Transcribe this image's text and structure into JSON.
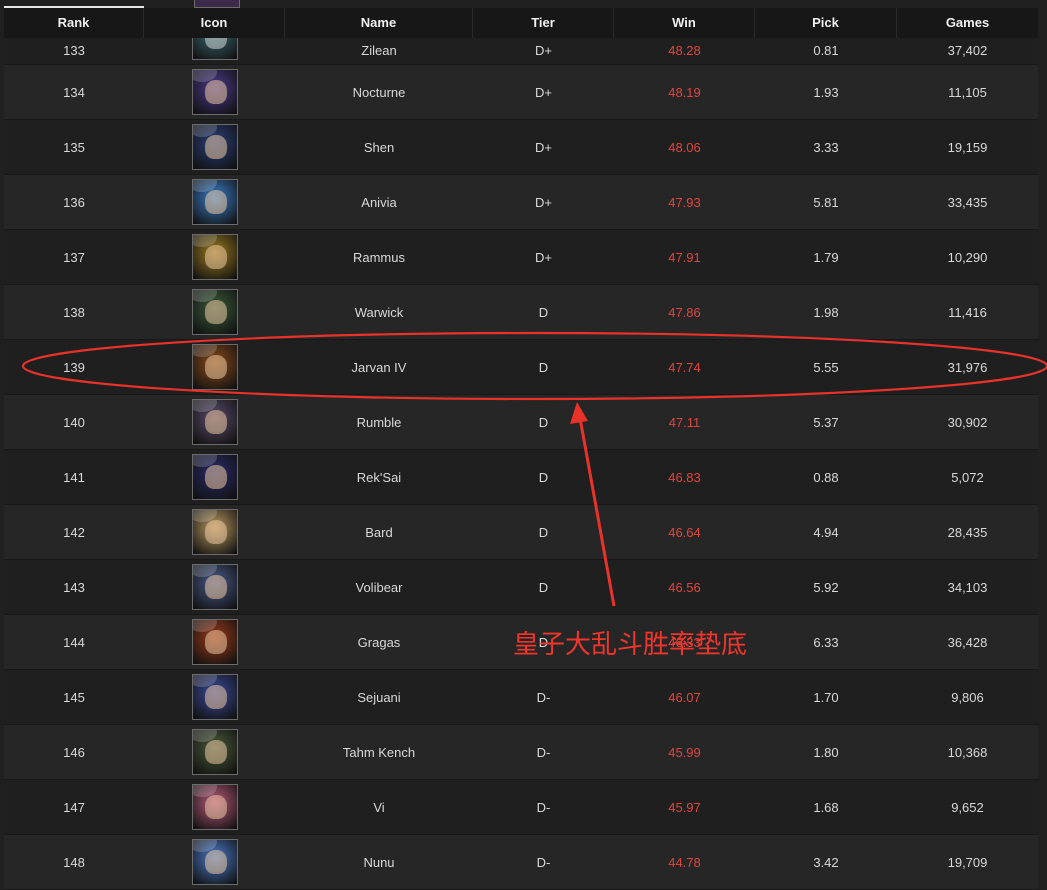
{
  "header": {
    "rank": "Rank",
    "icon": "Icon",
    "name": "Name",
    "tier": "Tier",
    "win": "Win",
    "pick": "Pick",
    "games": "Games"
  },
  "partial_row": {
    "rank": "133",
    "name": "Zilean",
    "tier": "D+",
    "win": "48.28",
    "pick": "0.81",
    "games": "37,402",
    "icon": "zilean-portrait",
    "color": "#3f6a72"
  },
  "rows": [
    {
      "rank": "134",
      "name": "Nocturne",
      "tier": "D+",
      "win": "48.19",
      "pick": "1.93",
      "games": "11,105",
      "icon": "nocturne-portrait",
      "color": "#4a3a8a"
    },
    {
      "rank": "135",
      "name": "Shen",
      "tier": "D+",
      "win": "48.06",
      "pick": "3.33",
      "games": "19,159",
      "icon": "shen-portrait",
      "color": "#2b3f7a"
    },
    {
      "rank": "136",
      "name": "Anivia",
      "tier": "D+",
      "win": "47.93",
      "pick": "5.81",
      "games": "33,435",
      "icon": "anivia-portrait",
      "color": "#3a7ec8"
    },
    {
      "rank": "137",
      "name": "Rammus",
      "tier": "D+",
      "win": "47.91",
      "pick": "1.79",
      "games": "10,290",
      "icon": "rammus-portrait",
      "color": "#9a7a20"
    },
    {
      "rank": "138",
      "name": "Warwick",
      "tier": "D",
      "win": "47.86",
      "pick": "1.98",
      "games": "11,416",
      "icon": "warwick-portrait",
      "color": "#3b5a3a"
    },
    {
      "rank": "139",
      "name": "Jarvan IV",
      "tier": "D",
      "win": "47.74",
      "pick": "5.55",
      "games": "31,976",
      "icon": "jarvan-iv-portrait",
      "color": "#8a4a1a"
    },
    {
      "rank": "140",
      "name": "Rumble",
      "tier": "D",
      "win": "47.11",
      "pick": "5.37",
      "games": "30,902",
      "icon": "rumble-portrait",
      "color": "#5a4a6a"
    },
    {
      "rank": "141",
      "name": "Rek'Sai",
      "tier": "D",
      "win": "46.83",
      "pick": "0.88",
      "games": "5,072",
      "icon": "reksai-portrait",
      "color": "#2a2a6a"
    },
    {
      "rank": "142",
      "name": "Bard",
      "tier": "D",
      "win": "46.64",
      "pick": "4.94",
      "games": "28,435",
      "icon": "bard-portrait",
      "color": "#b89860"
    },
    {
      "rank": "143",
      "name": "Volibear",
      "tier": "D",
      "win": "46.56",
      "pick": "5.92",
      "games": "34,103",
      "icon": "volibear-portrait",
      "color": "#4a5a8a"
    },
    {
      "rank": "144",
      "name": "Gragas",
      "tier": "D",
      "win": "46.33",
      "pick": "6.33",
      "games": "36,428",
      "icon": "gragas-portrait",
      "color": "#9a3a1a"
    },
    {
      "rank": "145",
      "name": "Sejuani",
      "tier": "D-",
      "win": "46.07",
      "pick": "1.70",
      "games": "9,806",
      "icon": "sejuani-portrait",
      "color": "#3a4a9a"
    },
    {
      "rank": "146",
      "name": "Tahm Kench",
      "tier": "D-",
      "win": "45.99",
      "pick": "1.80",
      "games": "10,368",
      "icon": "tahm-kench-portrait",
      "color": "#4a5a3a"
    },
    {
      "rank": "147",
      "name": "Vi",
      "tier": "D-",
      "win": "45.97",
      "pick": "1.68",
      "games": "9,652",
      "icon": "vi-portrait",
      "color": "#b85a7a"
    },
    {
      "rank": "148",
      "name": "Nunu",
      "tier": "D-",
      "win": "44.78",
      "pick": "3.42",
      "games": "19,709",
      "icon": "nunu-portrait",
      "color": "#4a7ac8"
    }
  ],
  "annotation": {
    "text": "皇子大乱斗胜率垫底",
    "color": "#f0362c"
  }
}
